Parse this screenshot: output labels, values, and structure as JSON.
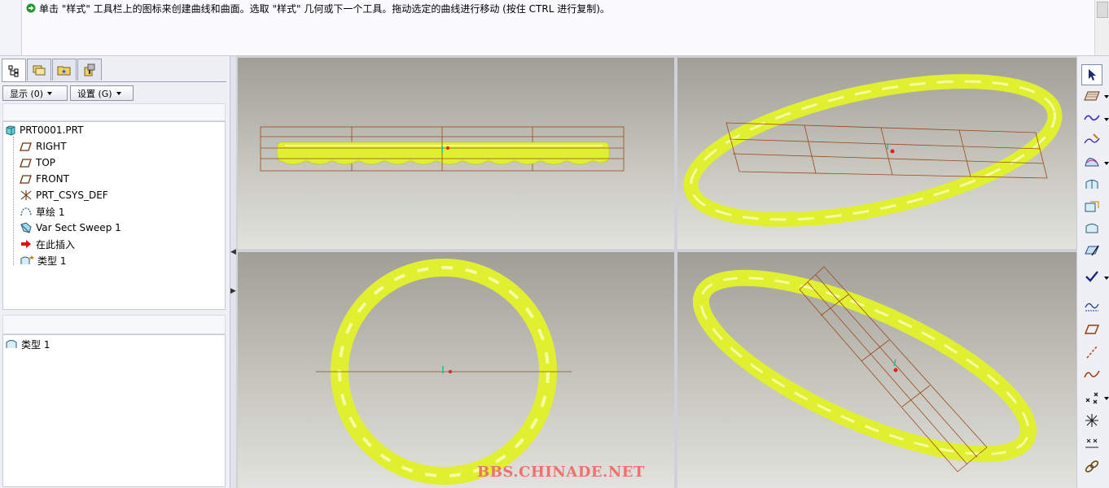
{
  "message": {
    "text": "单击 \"样式\" 工具栏上的图标来创建曲线和曲面。选取 \"样式\" 几何或下一个工具。拖动选定的曲线进行移动 (按住 CTRL 进行复制)。"
  },
  "navigator": {
    "tabs": [
      {
        "icon": "model-tree-icon"
      },
      {
        "icon": "folder-browser-icon"
      },
      {
        "icon": "favorites-icon"
      },
      {
        "icon": "connections-icon"
      }
    ],
    "show_label": "显示 (0)",
    "settings_label": "设置 (G)"
  },
  "tree": {
    "root": "PRT0001.PRT",
    "items": [
      {
        "label": "RIGHT",
        "icon": "datum-plane-icon"
      },
      {
        "label": "TOP",
        "icon": "datum-plane-icon"
      },
      {
        "label": "FRONT",
        "icon": "datum-plane-icon"
      },
      {
        "label": "PRT_CSYS_DEF",
        "icon": "coordinate-system-icon"
      },
      {
        "label": "草绘 1",
        "icon": "sketch-icon"
      },
      {
        "label": "Var Sect Sweep 1",
        "icon": "sweep-icon"
      },
      {
        "label": "在此插入",
        "icon": "insert-here-arrow-icon"
      },
      {
        "label": "类型 1",
        "icon": "style-feature-icon"
      }
    ]
  },
  "lower_tree": {
    "items": [
      {
        "label": "类型 1",
        "icon": "style-feature-icon"
      }
    ]
  },
  "watermark": "BBS.CHINADE.NET",
  "colors": {
    "part": "#e0f030",
    "datum_plane": "#9a4a1a",
    "background_top": "#a09e96",
    "background_bottom": "#e2e2de"
  },
  "right_toolbar": {
    "tools": [
      "select-arrow-icon",
      "sketch-plane-icon",
      "curve-icon",
      "edit-curve-icon",
      "surface-icon",
      "connect-surface-icon",
      "trim-surface-icon",
      "curve-edit-icon",
      "done-check-icon",
      "curvature-analysis-icon",
      "active-plane-icon",
      "internal-plane-icon",
      "free-curve-icon",
      "points-icon",
      "datum-points-icon",
      "offset-points-icon",
      "chain-link-icon"
    ]
  }
}
